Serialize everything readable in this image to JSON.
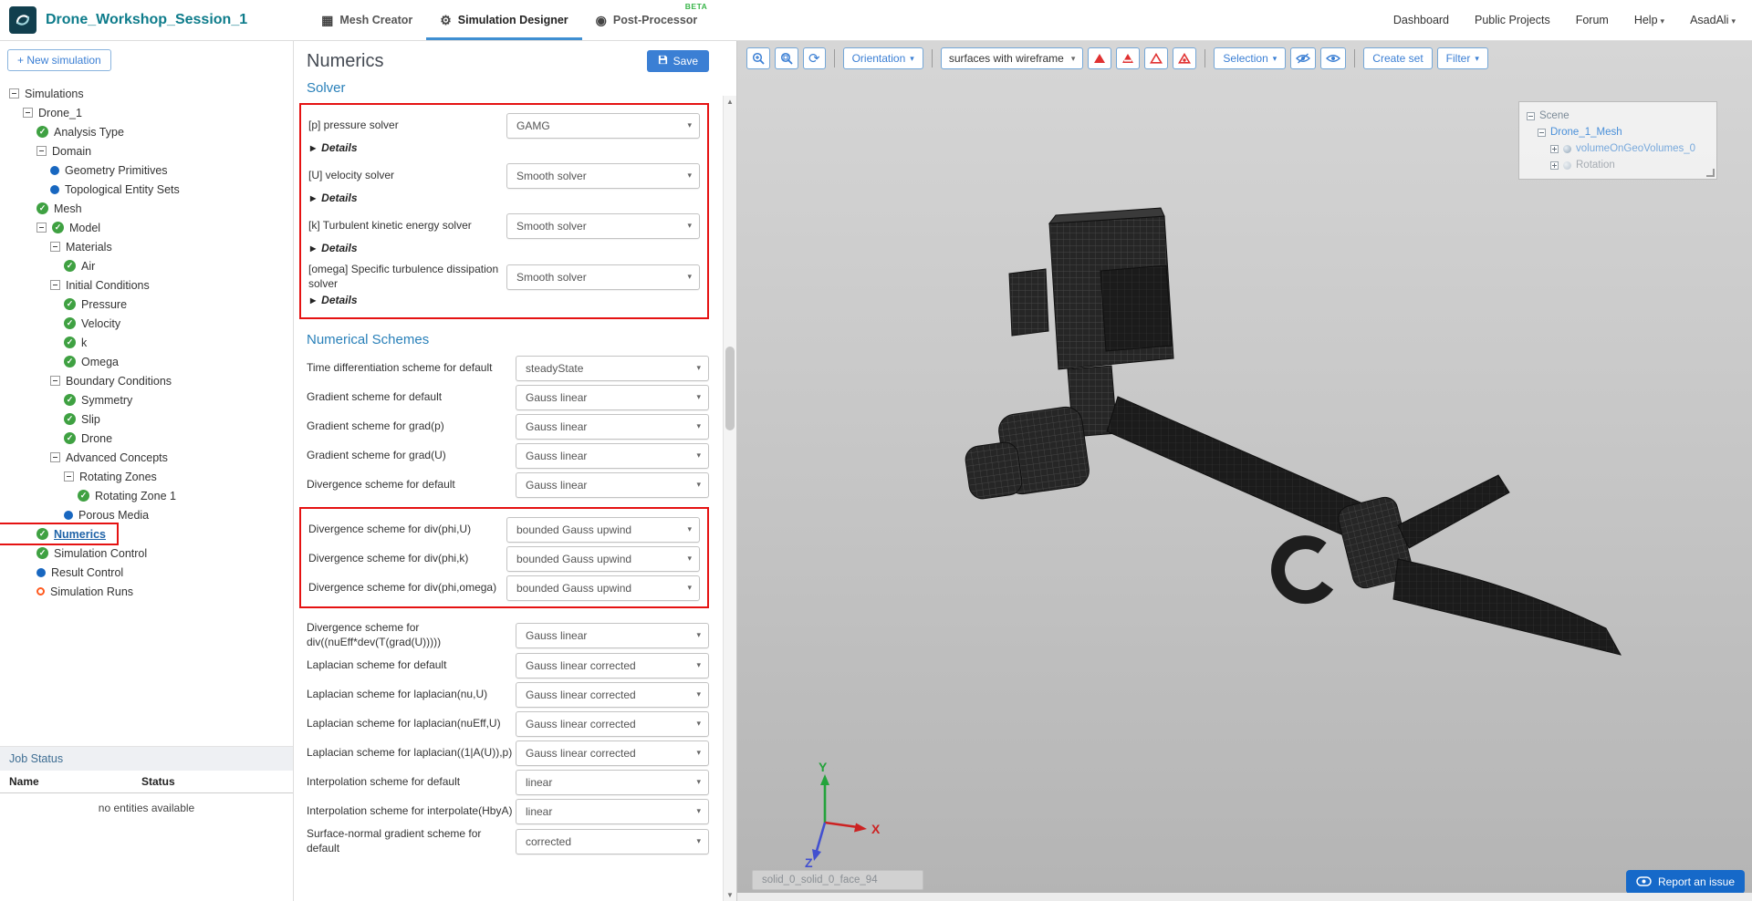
{
  "header": {
    "project_title": "Drone_Workshop_Session_1",
    "tabs": [
      {
        "label": "Mesh Creator",
        "icon": "grid-icon",
        "glyph": "▦",
        "active": false,
        "badge": ""
      },
      {
        "label": "Simulation Designer",
        "icon": "gears-icon",
        "glyph": "⚙",
        "active": true,
        "badge": ""
      },
      {
        "label": "Post-Processor",
        "icon": "gauge-icon",
        "glyph": "◉",
        "active": false,
        "badge": "BETA"
      }
    ],
    "nav": [
      {
        "label": "Dashboard",
        "caret": false
      },
      {
        "label": "Public Projects",
        "caret": false
      },
      {
        "label": "Forum",
        "caret": false
      },
      {
        "label": "Help",
        "caret": true
      },
      {
        "label": "AsadAli",
        "caret": true
      }
    ]
  },
  "sidebar": {
    "new_simulation": "+ New simulation",
    "tree": [
      {
        "label": "Simulations",
        "depth": 0,
        "icon": "none",
        "expander": true,
        "selected": false
      },
      {
        "label": "Drone_1",
        "depth": 1,
        "icon": "none",
        "expander": true,
        "selected": false
      },
      {
        "label": "Analysis Type",
        "depth": 2,
        "icon": "check",
        "expander": false,
        "selected": false
      },
      {
        "label": "Domain",
        "depth": 2,
        "icon": "none",
        "expander": true,
        "selected": false
      },
      {
        "label": "Geometry Primitives",
        "depth": 3,
        "icon": "dot",
        "expander": false,
        "selected": false
      },
      {
        "label": "Topological Entity Sets",
        "depth": 3,
        "icon": "dot",
        "expander": false,
        "selected": false
      },
      {
        "label": "Mesh",
        "depth": 2,
        "icon": "check",
        "expander": false,
        "selected": false
      },
      {
        "label": "Model",
        "depth": 2,
        "icon": "check",
        "expander": true,
        "selected": false
      },
      {
        "label": "Materials",
        "depth": 3,
        "icon": "none",
        "expander": true,
        "selected": false
      },
      {
        "label": "Air",
        "depth": 4,
        "icon": "check",
        "expander": false,
        "selected": false
      },
      {
        "label": "Initial Conditions",
        "depth": 3,
        "icon": "none",
        "expander": true,
        "selected": false
      },
      {
        "label": "Pressure",
        "depth": 4,
        "icon": "check",
        "expander": false,
        "selected": false
      },
      {
        "label": "Velocity",
        "depth": 4,
        "icon": "check",
        "expander": false,
        "selected": false
      },
      {
        "label": "k",
        "depth": 4,
        "icon": "check",
        "expander": false,
        "selected": false
      },
      {
        "label": "Omega",
        "depth": 4,
        "icon": "check",
        "expander": false,
        "selected": false
      },
      {
        "label": "Boundary Conditions",
        "depth": 3,
        "icon": "none",
        "expander": true,
        "selected": false
      },
      {
        "label": "Symmetry",
        "depth": 4,
        "icon": "check",
        "expander": false,
        "selected": false
      },
      {
        "label": "Slip",
        "depth": 4,
        "icon": "check",
        "expander": false,
        "selected": false
      },
      {
        "label": "Drone",
        "depth": 4,
        "icon": "check",
        "expander": false,
        "selected": false
      },
      {
        "label": "Advanced Concepts",
        "depth": 3,
        "icon": "none",
        "expander": true,
        "selected": false
      },
      {
        "label": "Rotating Zones",
        "depth": 4,
        "icon": "none",
        "expander": true,
        "selected": false
      },
      {
        "label": "Rotating Zone 1",
        "depth": 5,
        "icon": "check",
        "expander": false,
        "selected": false
      },
      {
        "label": "Porous Media",
        "depth": 4,
        "icon": "dot",
        "expander": false,
        "selected": false
      },
      {
        "label": "Numerics",
        "depth": 2,
        "icon": "check",
        "expander": false,
        "selected": true
      },
      {
        "label": "Simulation Control",
        "depth": 2,
        "icon": "check",
        "expander": false,
        "selected": false
      },
      {
        "label": "Result Control",
        "depth": 2,
        "icon": "dot",
        "expander": false,
        "selected": false
      },
      {
        "label": "Simulation Runs",
        "depth": 2,
        "icon": "ring",
        "expander": false,
        "selected": false
      }
    ],
    "job_status": {
      "title": "Job Status",
      "columns": [
        "Name",
        "Status"
      ],
      "empty_message": "no entities available"
    }
  },
  "panel": {
    "title": "Numerics",
    "save_label": "Save",
    "sections": [
      {
        "title": "Solver",
        "groups": [
          {
            "boxed": true,
            "rows": [
              {
                "label": "[p] pressure solver",
                "value": "GAMG",
                "details": "Details"
              },
              {
                "label": "[U] velocity solver",
                "value": "Smooth solver",
                "details": "Details"
              },
              {
                "label": "[k] Turbulent kinetic energy solver",
                "value": "Smooth solver",
                "details": "Details"
              },
              {
                "label": "[omega] Specific turbulence dissipation solver",
                "value": "Smooth solver",
                "details": "Details"
              }
            ]
          }
        ]
      },
      {
        "title": "Numerical Schemes",
        "groups": [
          {
            "boxed": false,
            "rows": [
              {
                "label": "Time differentiation scheme for default",
                "value": "steadyState"
              },
              {
                "label": "Gradient scheme for default",
                "value": "Gauss linear"
              },
              {
                "label": "Gradient scheme for grad(p)",
                "value": "Gauss linear"
              },
              {
                "label": "Gradient scheme for grad(U)",
                "value": "Gauss linear"
              },
              {
                "label": "Divergence scheme for default",
                "value": "Gauss linear"
              }
            ]
          },
          {
            "boxed": true,
            "rows": [
              {
                "label": "Divergence scheme for div(phi,U)",
                "value": "bounded Gauss upwind"
              },
              {
                "label": "Divergence scheme for div(phi,k)",
                "value": "bounded Gauss upwind"
              },
              {
                "label": "Divergence scheme for div(phi,omega)",
                "value": "bounded Gauss upwind"
              }
            ]
          },
          {
            "boxed": false,
            "rows": [
              {
                "label": "Divergence scheme for div((nuEff*dev(T(grad(U)))))",
                "value": "Gauss linear"
              },
              {
                "label": "Laplacian scheme for default",
                "value": "Gauss linear corrected"
              },
              {
                "label": "Laplacian scheme for laplacian(nu,U)",
                "value": "Gauss linear corrected"
              },
              {
                "label": "Laplacian scheme for laplacian(nuEff,U)",
                "value": "Gauss linear corrected"
              },
              {
                "label": "Laplacian scheme for laplacian((1|A(U)),p)",
                "value": "Gauss linear corrected"
              },
              {
                "label": "Interpolation scheme for default",
                "value": "linear"
              },
              {
                "label": "Interpolation scheme for interpolate(HbyA)",
                "value": "linear"
              },
              {
                "label": "Surface-normal gradient scheme for default",
                "value": "corrected"
              }
            ]
          }
        ]
      }
    ]
  },
  "viewport": {
    "toolbar": {
      "orientation": "Orientation",
      "render_mode": "surfaces with wireframe",
      "selection": "Selection",
      "create_set": "Create set",
      "filter": "Filter"
    },
    "scene_tree": {
      "scene": "Scene",
      "mesh_name": "Drone_1_Mesh",
      "volume": "volumeOnGeoVolumes_0",
      "rotation": "Rotation"
    },
    "face_label": "solid_0_solid_0_face_94",
    "axes": {
      "x": "X",
      "y": "Y",
      "z": "Z"
    },
    "report_issue": "Report an issue"
  },
  "colors": {
    "accent_blue": "#3b7fd4",
    "teal_title": "#0e7c8b",
    "check_green": "#3fa142",
    "dot_blue": "#1867c0",
    "run_orange": "#ff5a1f",
    "highlight_red": "#e51212",
    "beta_green": "#39b54a"
  }
}
